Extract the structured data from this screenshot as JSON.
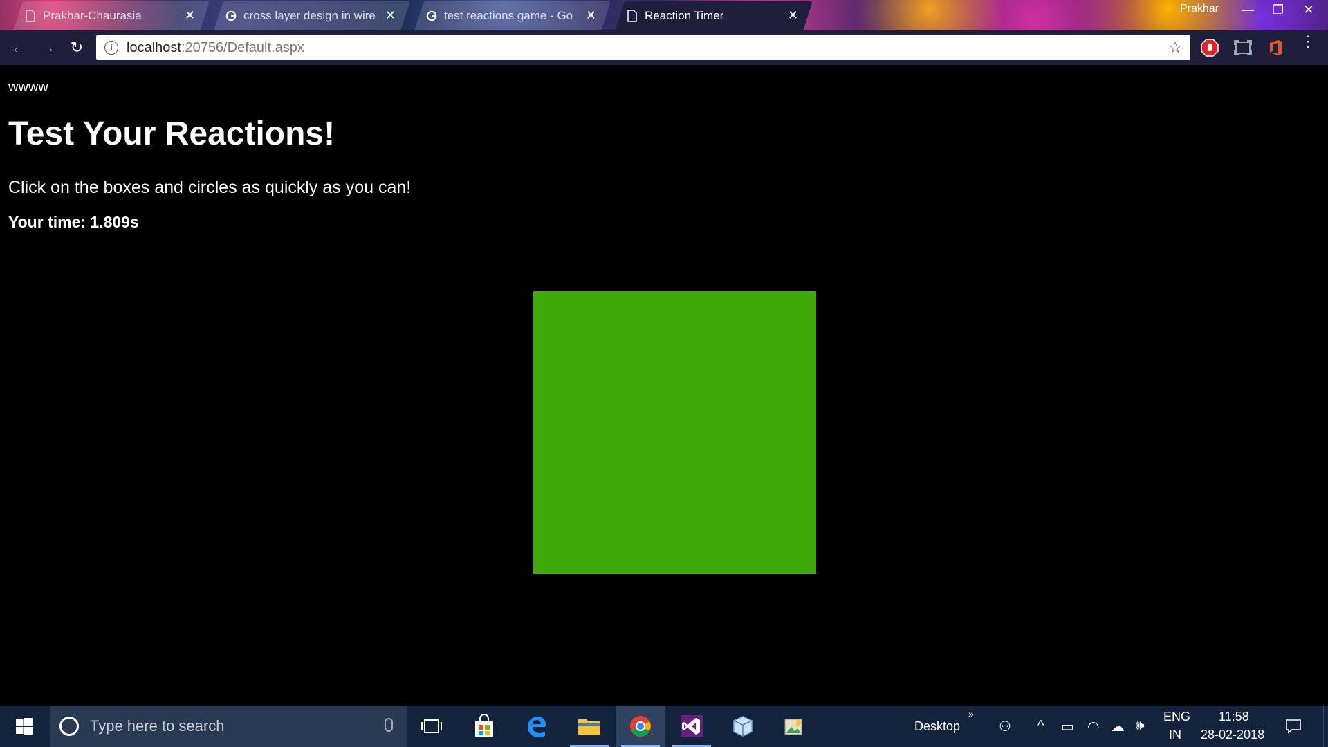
{
  "browser": {
    "tabs": [
      {
        "title": "Prakhar-Chaurasia",
        "icon": "page-icon",
        "active": false
      },
      {
        "title": "cross layer design in wire",
        "icon": "google-icon",
        "active": false
      },
      {
        "title": "test reactions game - Go",
        "icon": "google-icon",
        "active": false
      },
      {
        "title": "Reaction Timer",
        "icon": "page-icon",
        "active": true
      }
    ],
    "profile_name": "Prakhar",
    "url_host": "localhost",
    "url_rest": ":20756/Default.aspx"
  },
  "page": {
    "site_label": "wwww",
    "title": "Test Your Reactions!",
    "instructions": "Click on the boxes and circles as quickly as you can!",
    "time_text": "Your time: 1.809s",
    "target_color": "#3fa90a"
  },
  "taskbar": {
    "search_placeholder": "Type here to search",
    "desktop_label": "Desktop",
    "lang_primary": "ENG",
    "lang_secondary": "IN",
    "time": "11:58",
    "date": "28-02-2018"
  }
}
